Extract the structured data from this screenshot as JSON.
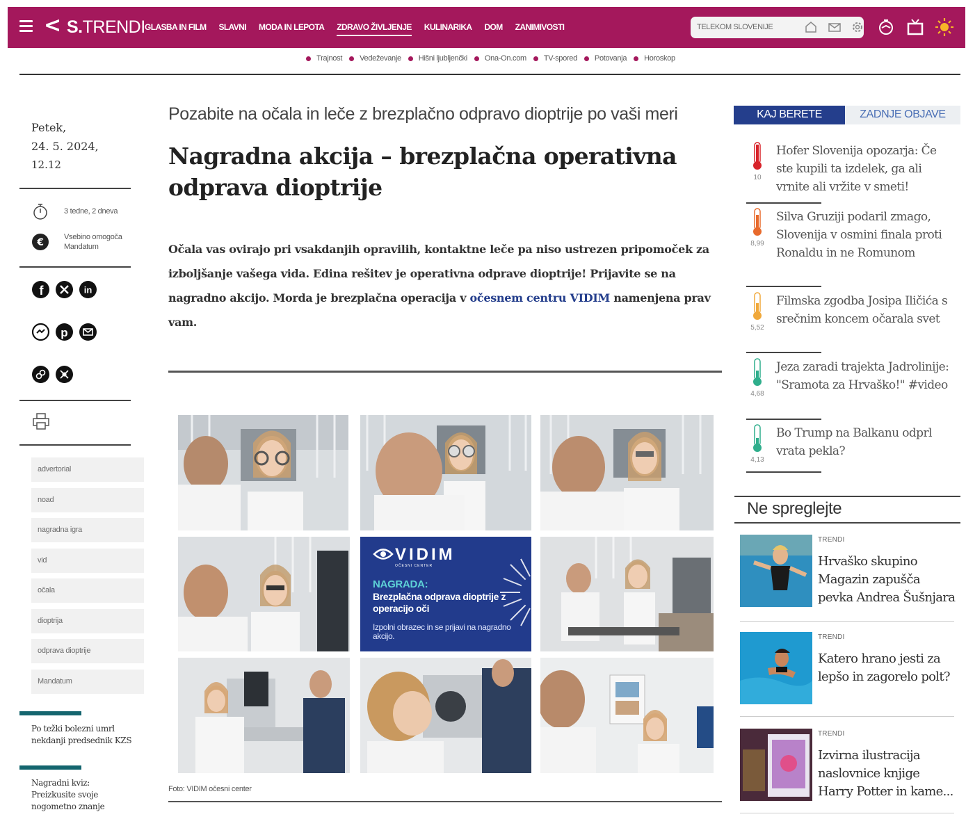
{
  "header": {
    "logo_bold": "S.",
    "logo_light": "TRENDI",
    "nav": [
      "GLASBA IN FILM",
      "SLAVNI",
      "MODA IN LEPOTA",
      "ZDRAVO ŽIVLJENJE",
      "KULINARIKA",
      "DOM",
      "ZANIMIVOSTI"
    ],
    "active_nav": "ZDRAVO ŽIVLJENJE",
    "telekom_label": "TELEKOM SLOVENIJE",
    "colors": {
      "brand": "#a4185c",
      "accent_blue": "#243e8c",
      "teal": "#14656e"
    }
  },
  "subnav": [
    "Trajnost",
    "Vedeževanje",
    "Hišni ljubljenčki",
    "Ona-On.com",
    "TV-spored",
    "Potovanja",
    "Horoskop"
  ],
  "sidebar": {
    "date_day": "Petek,",
    "date": "24. 5. 2024,",
    "time": "12.12",
    "age_text": "3 tedne, 2 dneva",
    "sponsor_line1": "Vsebino omogoča",
    "sponsor_line2": "Mandatum",
    "share_icons": [
      "facebook-icon",
      "x-icon",
      "linkedin-icon",
      "messenger-icon",
      "pinterest-icon",
      "email-icon",
      "copy-link-icon",
      "more-icon"
    ],
    "tags": [
      "advertorial",
      "noad",
      "nagradna igra",
      "vid",
      "očala",
      "dioptrija",
      "odprava dioptrije",
      "Mandatum"
    ],
    "news": [
      "Po težki bolezni umrl nekdanji predsednik KZS",
      "Nagradni kviz: Preizkusite svoje nogometno znanje"
    ]
  },
  "article": {
    "subtitle": "Pozabite na očala in leče z brezplačno odpravo dioptrije po vaši meri",
    "title": "Nagradna akcija – brezplačna operativna odprava dioptrije",
    "lead_part1": "Očala vas ovirajo pri vsakdanjih opravilih, kontaktne leče pa niso ustrezen pripomoček za izboljšanje vašega vida. Edina rešitev je operativna odprave dioptrije! Prijavite se na nagradno akcijo. Morda je brezplačna operacija v ",
    "lead_link": "očesnem centru VIDIM",
    "lead_part2": " namenjena prav vam.",
    "caption": "Foto: VIDIM očesni center",
    "ad": {
      "brand": "VIDIM",
      "brand_sub": "OČESNI CENTER",
      "label": "NAGRADA:",
      "prize": "Brezplačna odprava dioptrije z operacijo oči",
      "cta": "Izpolni obrazec in se prijavi na nagradno akcijo."
    }
  },
  "right": {
    "tab_active": "KAJ BERETE",
    "tab_other": "ZADNJE OBJAVE",
    "trending": [
      {
        "title": "Hofer Slovenija opozarja: Če ste kupili ta izdelek, ga ali vrnite ali vržite v smeti!",
        "value": "10",
        "color": "#d8232a"
      },
      {
        "title": "Silva Gruziji podaril zmago, Slovenija v osmini finala proti Ronaldu in ne Romunom",
        "value": "8,99",
        "color": "#e86a2c"
      },
      {
        "title": "Filmska zgodba Josipa Iličića s srečnim koncem očarala svet",
        "value": "5,52",
        "color": "#f0a83a"
      },
      {
        "title": "Jeza zaradi trajekta Jadrolinije: \"Sramota za Hrvaško!\" #video",
        "value": "4,68",
        "color": "#2fae8c"
      },
      {
        "title": "Bo Trump na Balkanu odprl vrata pekla?",
        "value": "4,13",
        "color": "#2fae8c"
      }
    ],
    "ne_spreglejte": "Ne spreglejte",
    "picks": [
      {
        "source": "TRENDI",
        "title": "Hrvaško skupino Magazin zapušča pevka Andrea Šušnjara"
      },
      {
        "source": "TRENDI",
        "title": "Katero hrano jesti za lepšo in zagorelo polt?"
      },
      {
        "source": "TRENDI",
        "title": "Izvirna ilustracija naslovnice knjige Harry Potter in kame..."
      }
    ]
  }
}
